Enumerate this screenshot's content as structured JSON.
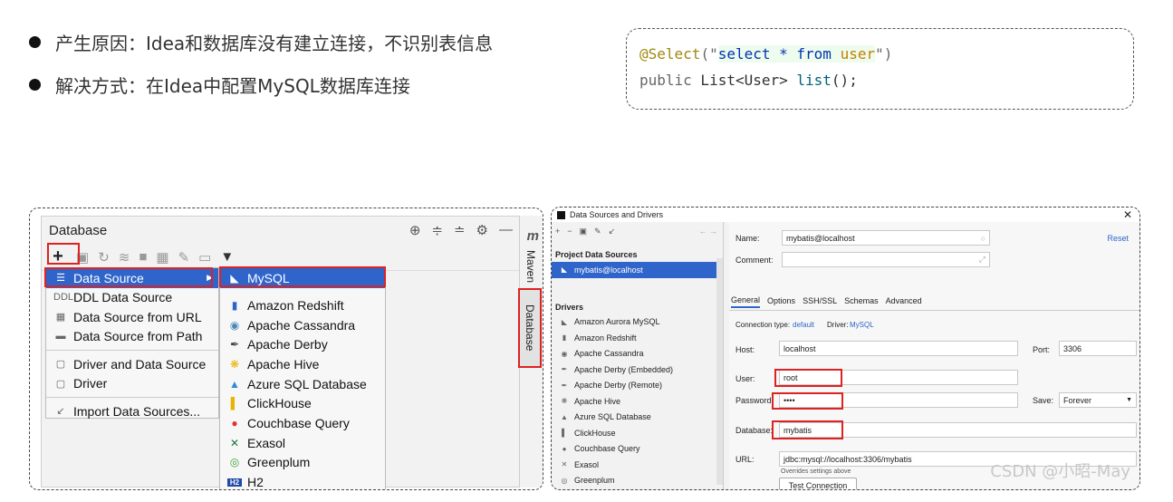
{
  "slide": {
    "bullets": [
      "产生原因：Idea和数据库没有建立连接，不识别表信息",
      "解决方式：在Idea中配置MySQL数据库连接"
    ],
    "code": {
      "annotation": "@Select",
      "open": "(\"",
      "sql": "select * from ",
      "table": "user",
      "close": "\")",
      "line2_kw": "public",
      "line2_type": " List<User> ",
      "line2_fn": "list",
      "line2_end": "();"
    }
  },
  "ide": {
    "panel_title": "Database",
    "menu1": [
      {
        "icon": "list-icon",
        "glyph": "☰",
        "label": "Data Source",
        "selected": true
      },
      {
        "icon": "ddl-icon",
        "glyph": "DDL",
        "label": "DDL Data Source"
      },
      {
        "icon": "url-icon",
        "glyph": "▦",
        "label": "Data Source from URL"
      },
      {
        "icon": "folder-icon",
        "glyph": "▬",
        "label": "Data Source from Path"
      },
      {
        "icon": "driver-ds-icon",
        "glyph": "▢",
        "label": "Driver and Data Source"
      },
      {
        "icon": "driver-icon",
        "glyph": "▢",
        "label": "Driver"
      },
      {
        "icon": "import-icon",
        "glyph": "↙",
        "label": "Import Data Sources..."
      }
    ],
    "menu2": [
      {
        "label": "MySQL",
        "glyph": "◣",
        "color": "#ffffff",
        "selected": true
      },
      {
        "label": "Amazon Redshift",
        "glyph": "▮",
        "color": "#2f65ca"
      },
      {
        "label": "Apache Cassandra",
        "glyph": "◉",
        "color": "#4a8ab8"
      },
      {
        "label": "Apache Derby",
        "glyph": "✒",
        "color": "#444444"
      },
      {
        "label": "Apache Hive",
        "glyph": "❋",
        "color": "#e8b400"
      },
      {
        "label": "Azure SQL Database",
        "glyph": "▲",
        "color": "#2f8ad0"
      },
      {
        "label": "ClickHouse",
        "glyph": "▌",
        "color": "#e8b400"
      },
      {
        "label": "Couchbase Query",
        "glyph": "●",
        "color": "#e23333"
      },
      {
        "label": "Exasol",
        "glyph": "✕",
        "color": "#1a7a3a"
      },
      {
        "label": "Greenplum",
        "glyph": "◎",
        "color": "#3aa23a"
      },
      {
        "label": "H2",
        "glyph": "H2",
        "color": "#1f4aa8"
      }
    ],
    "side_m": "m",
    "side_maven": "Maven",
    "side_database": "Database"
  },
  "dialog": {
    "title": "Data Sources and Drivers",
    "project_header": "Project Data Sources",
    "project_item": "mybatis@localhost",
    "drivers_header": "Drivers",
    "drivers": [
      "Amazon Aurora MySQL",
      "Amazon Redshift",
      "Apache Cassandra",
      "Apache Derby (Embedded)",
      "Apache Derby (Remote)",
      "Apache Hive",
      "Azure SQL Database",
      "ClickHouse",
      "Couchbase Query",
      "Exasol",
      "Greenplum"
    ],
    "name_label": "Name:",
    "name_value": "mybatis@localhost",
    "comment_label": "Comment:",
    "reset": "Reset",
    "tabs": [
      "General",
      "Options",
      "SSH/SSL",
      "Schemas",
      "Advanced"
    ],
    "conn_type_label": "Connection type:",
    "conn_type_value": "default",
    "driver_label": "Driver:",
    "driver_value": "MySQL",
    "host_label": "Host:",
    "host_value": "localhost",
    "port_label": "Port:",
    "port_value": "3306",
    "user_label": "User:",
    "user_value": "root",
    "password_label": "Password:",
    "password_value": "••••",
    "save_label": "Save:",
    "save_value": "Forever",
    "database_label": "Database:",
    "database_value": "mybatis",
    "url_label": "URL:",
    "url_value": "jdbc:mysql://localhost:3306/mybatis",
    "url_hint": "Overrides settings above",
    "test_button": "Test Connection"
  },
  "watermark": "CSDN @小昭-May"
}
